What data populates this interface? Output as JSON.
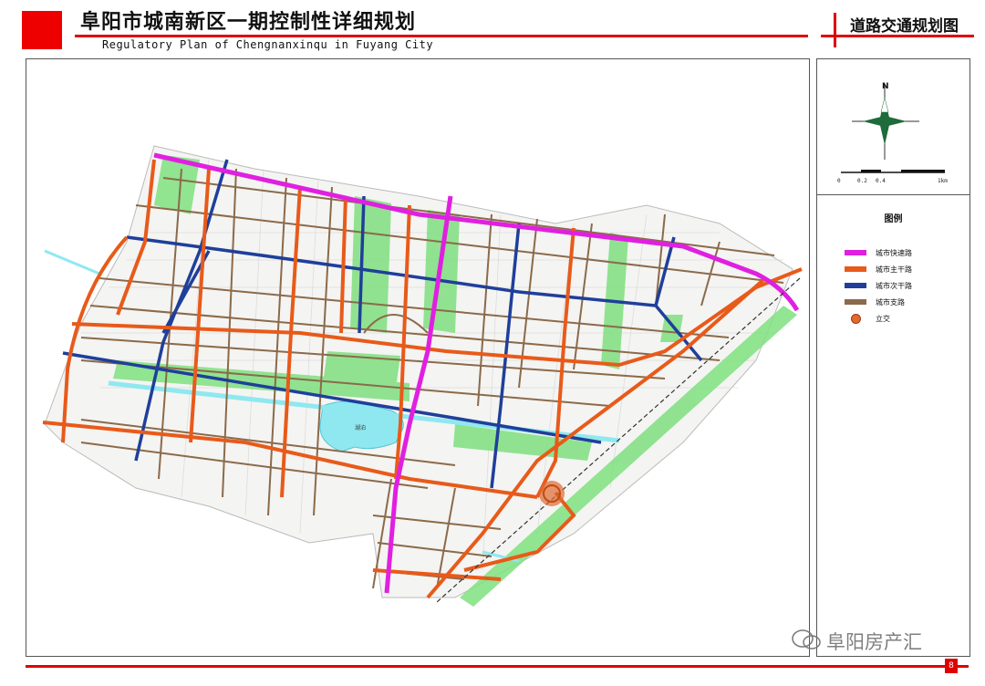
{
  "header": {
    "title_cn": "阜阳市城南新区一期控制性详细规划",
    "title_en": "Regulatory Plan of Chengnanxinqu in Fuyang City",
    "drawing_title": "道路交通规划图"
  },
  "compass": {
    "north": "N"
  },
  "scale": {
    "labels": [
      "0",
      "0.2",
      "0.4",
      "1km"
    ]
  },
  "legend": {
    "title": "图例",
    "items": [
      {
        "label": "城市快速路",
        "color": "#e020e0"
      },
      {
        "label": "城市主干路",
        "color": "#e85a1a"
      },
      {
        "label": "城市次干路",
        "color": "#1f3f9a"
      },
      {
        "label": "城市支路",
        "color": "#8b6a4a"
      },
      {
        "label": "立交",
        "color": "#e06a30"
      }
    ]
  },
  "map": {
    "colors": {
      "expressway": "#e020e0",
      "arterial": "#e85a1a",
      "secondary": "#1f3f9a",
      "branch": "#8b6a4a",
      "green": "#7fe07f",
      "water": "#8fe8f0",
      "rail": "#333333"
    },
    "lake_label": "湖泊"
  },
  "footer": {
    "page_number": "8",
    "watermark": "阜阳房产汇"
  }
}
